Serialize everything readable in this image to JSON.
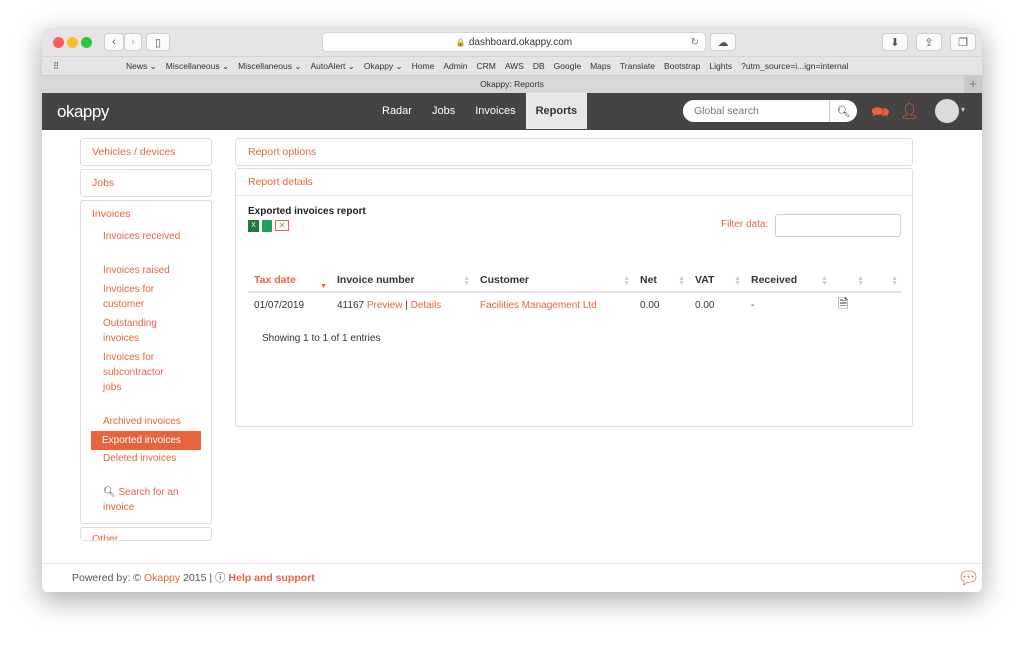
{
  "browser": {
    "url": "dashboard.okappy.com",
    "tab_title": "Okappy: Reports",
    "bookmarks": [
      "News ⌄",
      "Miscellaneous ⌄",
      "Miscellaneous ⌄",
      "AutoAlert ⌄",
      "Okappy ⌄",
      "Home",
      "Admin",
      "CRM",
      "AWS",
      "DB",
      "Google",
      "Maps",
      "Translate",
      "Bootstrap",
      "Lights",
      "?utm_source=i...ign=internal"
    ]
  },
  "nav": {
    "logo": "okappy",
    "items": [
      "Radar",
      "Jobs",
      "Invoices",
      "Reports"
    ],
    "active": "Reports",
    "search_placeholder": "Global search"
  },
  "sidebar": {
    "sections": [
      "Vehicles / devices",
      "Jobs",
      "Invoices"
    ],
    "invoice_items": [
      "Invoices received",
      "Invoices raised",
      "Invoices for customer",
      "Outstanding invoices",
      "Invoices for subcontractor jobs",
      "Archived invoices",
      "Exported invoices",
      "Deleted invoices"
    ],
    "active": "Exported invoices",
    "search_link": "Search for an invoice",
    "other": "Other"
  },
  "main": {
    "report_options": "Report options",
    "report_details": "Report details",
    "report_title": "Exported invoices report",
    "filter_label": "Filter data:",
    "filter_value": "",
    "columns": [
      "Tax date",
      "Invoice number",
      "Customer",
      "Net",
      "VAT",
      "Received",
      "",
      ""
    ],
    "rows": [
      {
        "tax_date": "01/07/2019",
        "invoice_number": "41167",
        "preview": "Preview",
        "sep": "|",
        "details": "Details",
        "customer": "Facilities Management Ltd",
        "net": "0.00",
        "vat": "0.00",
        "received": "-"
      }
    ],
    "info": "Showing 1 to 1 of 1 entries"
  },
  "footer": {
    "powered": "Powered by: ©",
    "brand": "Okappy",
    "year": "2015 |",
    "help": "Help and support"
  },
  "colors": {
    "accent": "#e8643c",
    "navbar": "#444444"
  }
}
